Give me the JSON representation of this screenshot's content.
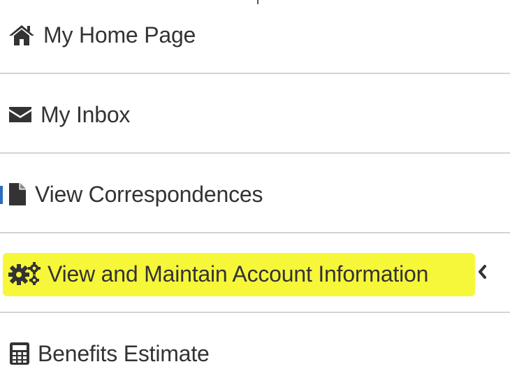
{
  "nav": {
    "items": [
      {
        "label": "My Home Page",
        "icon": "home-icon"
      },
      {
        "label": "My Inbox",
        "icon": "envelope-icon"
      },
      {
        "label": "View Correspondences",
        "icon": "file-icon"
      },
      {
        "label": "View and Maintain Account Information",
        "icon": "gears-icon",
        "highlighted": true,
        "expandable": true
      },
      {
        "label": "Benefits Estimate",
        "icon": "calculator-icon"
      }
    ],
    "expand_icon": "chevron-left-icon"
  },
  "colors": {
    "text": "#333333",
    "icon": "#333333",
    "divider": "#d4d4d4",
    "highlight": "#f7f73a",
    "active_indicator": "#2a6ebb"
  }
}
